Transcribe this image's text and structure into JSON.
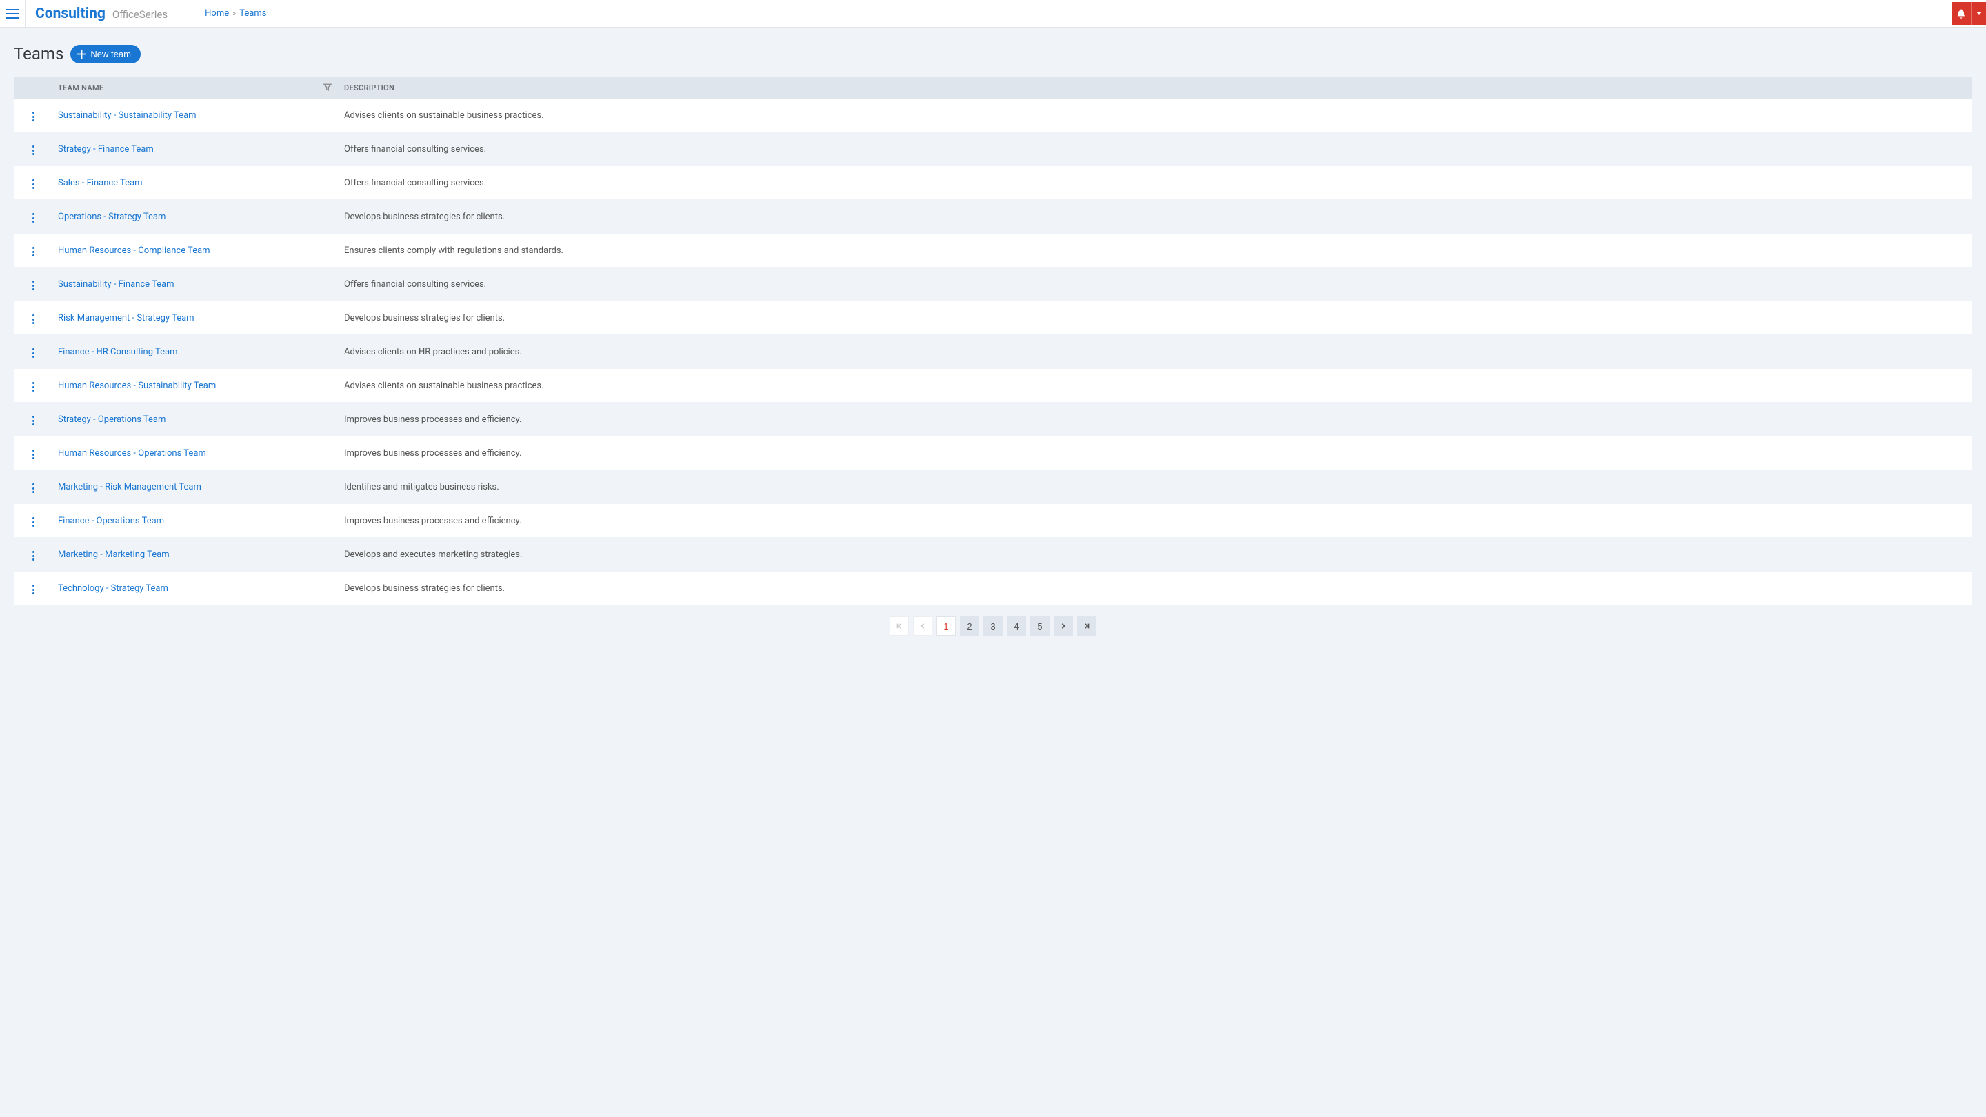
{
  "brand": {
    "main": "Consulting",
    "sub": "OfficeSeries"
  },
  "breadcrumb": {
    "home": "Home",
    "current": "Teams"
  },
  "page": {
    "title": "Teams",
    "new_btn": "New team"
  },
  "table": {
    "headers": {
      "name": "Team Name",
      "desc": "Description"
    },
    "rows": [
      {
        "name": "Sustainability - Sustainability Team",
        "desc": "Advises clients on sustainable business practices."
      },
      {
        "name": "Strategy - Finance Team",
        "desc": "Offers financial consulting services."
      },
      {
        "name": "Sales - Finance Team",
        "desc": "Offers financial consulting services."
      },
      {
        "name": "Operations - Strategy Team",
        "desc": "Develops business strategies for clients."
      },
      {
        "name": "Human Resources - Compliance Team",
        "desc": "Ensures clients comply with regulations and standards."
      },
      {
        "name": "Sustainability - Finance Team",
        "desc": "Offers financial consulting services."
      },
      {
        "name": "Risk Management - Strategy Team",
        "desc": "Develops business strategies for clients."
      },
      {
        "name": "Finance - HR Consulting Team",
        "desc": "Advises clients on HR practices and policies."
      },
      {
        "name": "Human Resources - Sustainability Team",
        "desc": "Advises clients on sustainable business practices."
      },
      {
        "name": "Strategy - Operations Team",
        "desc": "Improves business processes and efficiency."
      },
      {
        "name": "Human Resources - Operations Team",
        "desc": "Improves business processes and efficiency."
      },
      {
        "name": "Marketing - Risk Management Team",
        "desc": "Identifies and mitigates business risks."
      },
      {
        "name": "Finance - Operations Team",
        "desc": "Improves business processes and efficiency."
      },
      {
        "name": "Marketing - Marketing Team",
        "desc": "Develops and executes marketing strategies."
      },
      {
        "name": "Technology - Strategy Team",
        "desc": "Develops business strategies for clients."
      }
    ]
  },
  "pagination": {
    "pages": [
      "1",
      "2",
      "3",
      "4",
      "5"
    ],
    "active": "1"
  }
}
